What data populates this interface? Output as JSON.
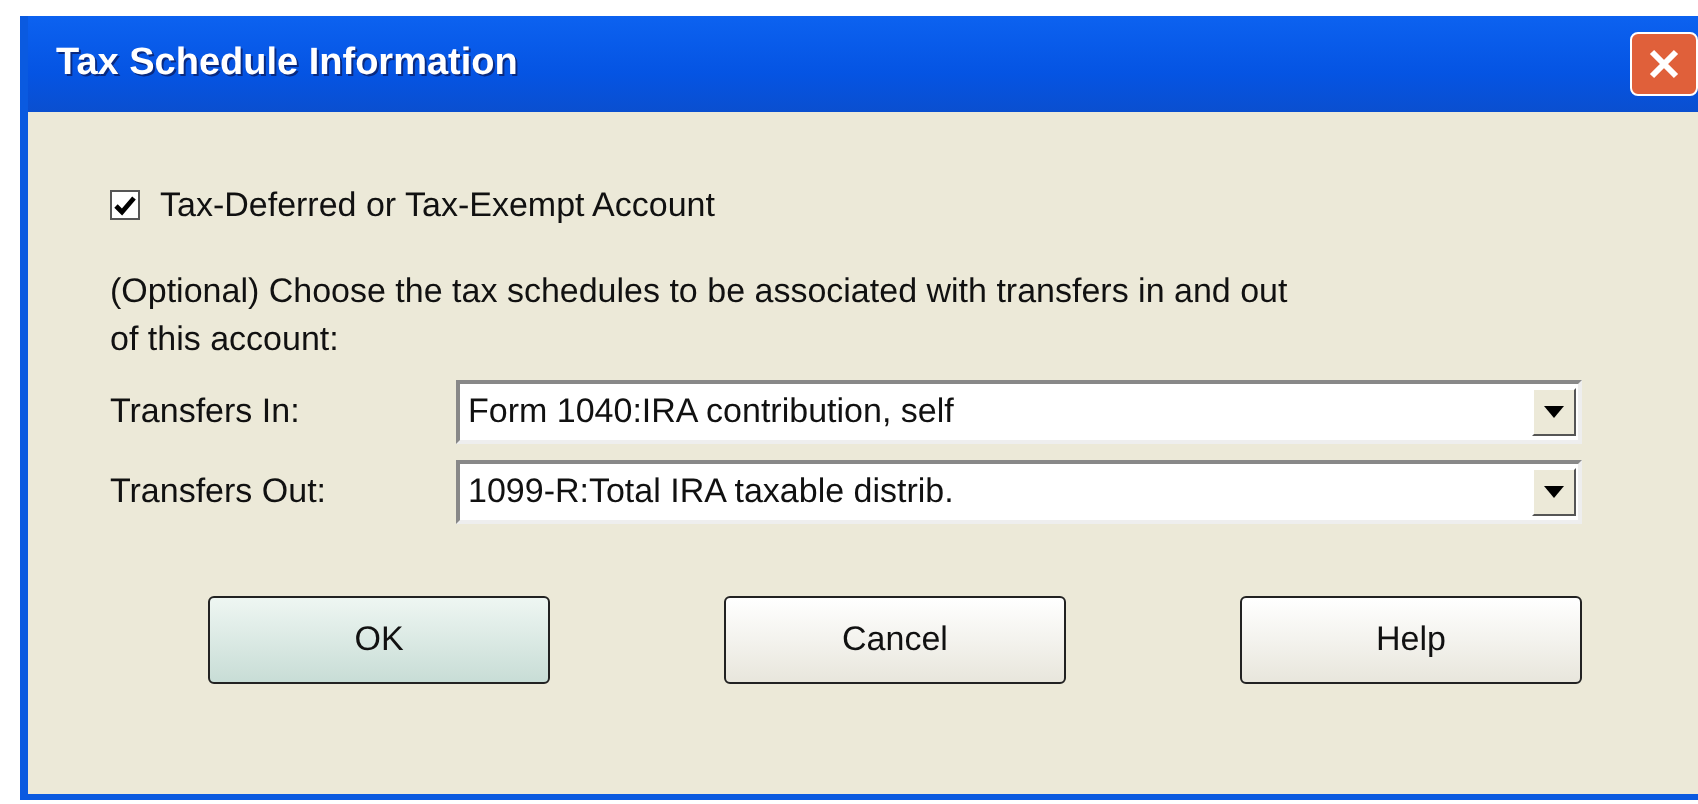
{
  "window": {
    "title": "Tax Schedule Information"
  },
  "checkbox": {
    "label": "Tax-Deferred or Tax-Exempt Account",
    "checked": true
  },
  "instructions": "(Optional)  Choose the tax schedules to be associated with transfers in and out of this account:",
  "fields": [
    {
      "label": "Transfers In:",
      "value": "Form 1040:IRA contribution, self"
    },
    {
      "label": "Transfers Out:",
      "value": "1099-R:Total IRA taxable distrib."
    }
  ],
  "buttons": [
    {
      "label": "OK",
      "default": true
    },
    {
      "label": "Cancel",
      "default": false
    },
    {
      "label": "Help",
      "default": false
    }
  ]
}
